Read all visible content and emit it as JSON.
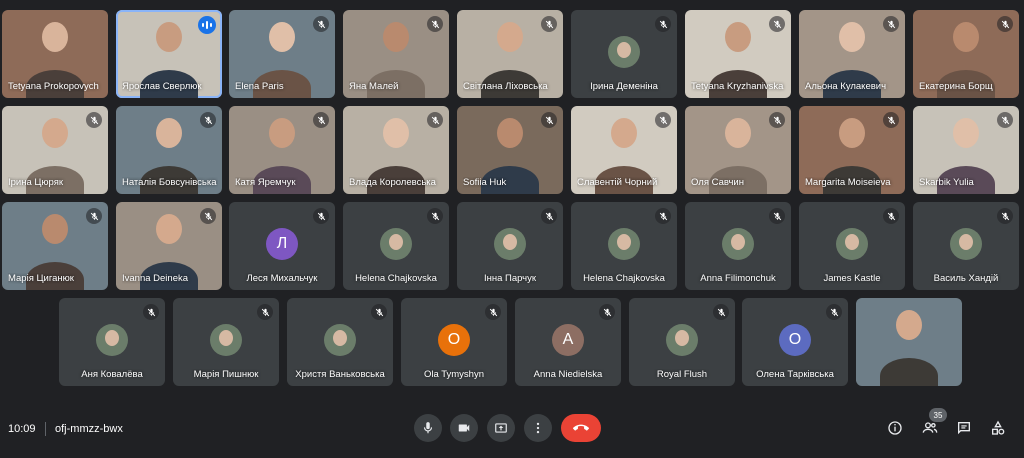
{
  "meeting": {
    "time": "10:09",
    "code": "ofj-mmzz-bwx",
    "participant_count": "35"
  },
  "colors": {
    "background": "#202124",
    "tile": "#3c4043",
    "end_call": "#ea4335",
    "active_speaker": "#1a73e8"
  },
  "rows": [
    [
      {
        "name": "Tetyana Prokopovych",
        "type": "video",
        "muted": false,
        "speaking": false
      },
      {
        "name": "Ярослав Сверлюк",
        "type": "video",
        "muted": false,
        "speaking": true
      },
      {
        "name": "Elena Paris",
        "type": "video",
        "muted": true
      },
      {
        "name": "Яна Малей",
        "type": "video",
        "muted": true
      },
      {
        "name": "Світлана Ліховська",
        "type": "video",
        "muted": true
      },
      {
        "name": "Ірина Деменіна",
        "type": "avatar",
        "avatar_kind": "photo",
        "muted": true
      },
      {
        "name": "Tetyana Kryzhanivska",
        "type": "video",
        "muted": true
      },
      {
        "name": "Альона Кулакевич",
        "type": "video",
        "muted": true
      },
      {
        "name": "Екатерина Борщ",
        "type": "video",
        "muted": true
      }
    ],
    [
      {
        "name": "Ірина Цюряк",
        "type": "video",
        "muted": true
      },
      {
        "name": "Наталія Бовсунівська",
        "type": "video",
        "muted": true
      },
      {
        "name": "Катя Яремчук",
        "type": "video",
        "muted": true
      },
      {
        "name": "Влада Королевська",
        "type": "video",
        "muted": true
      },
      {
        "name": "Sofiia Huk",
        "type": "video",
        "muted": true
      },
      {
        "name": "Славентій Чорний",
        "type": "video",
        "muted": true
      },
      {
        "name": "Оля Савчин",
        "type": "video",
        "muted": true
      },
      {
        "name": "Margarita Moiseieva",
        "type": "video",
        "muted": true
      },
      {
        "name": "Skarbik Yulia",
        "type": "video",
        "muted": true
      }
    ],
    [
      {
        "name": "Марія Циганюк",
        "type": "video",
        "muted": true
      },
      {
        "name": "Ivanna Deineka",
        "type": "video",
        "muted": true
      },
      {
        "name": "Леся Михальчук",
        "type": "avatar",
        "avatar_kind": "letter",
        "letter": "Л",
        "avatar_color": "#7e57c2",
        "muted": true
      },
      {
        "name": "Helena Chajkovska",
        "type": "avatar",
        "avatar_kind": "photo",
        "muted": true
      },
      {
        "name": "Інна Парчук",
        "type": "avatar",
        "avatar_kind": "photo",
        "muted": true
      },
      {
        "name": "Helena Chajkovska",
        "type": "avatar",
        "avatar_kind": "photo",
        "muted": true
      },
      {
        "name": "Anna Filimonchuk",
        "type": "avatar",
        "avatar_kind": "photo",
        "muted": true
      },
      {
        "name": "James Kastle",
        "type": "avatar",
        "avatar_kind": "photo",
        "muted": true
      },
      {
        "name": "Василь Хандій",
        "type": "avatar",
        "avatar_kind": "photo",
        "muted": true
      }
    ],
    [
      {
        "name": "Аня Ковалёва",
        "type": "avatar",
        "avatar_kind": "photo",
        "muted": true
      },
      {
        "name": "Марія Пишнюк",
        "type": "avatar",
        "avatar_kind": "photo",
        "muted": true
      },
      {
        "name": "Христя Ваньковська",
        "type": "avatar",
        "avatar_kind": "photo",
        "muted": true
      },
      {
        "name": "Ola Tymyshyn",
        "type": "avatar",
        "avatar_kind": "letter",
        "letter": "O",
        "avatar_color": "#e8710a",
        "muted": true
      },
      {
        "name": "Anna Niedielska",
        "type": "avatar",
        "avatar_kind": "letter",
        "letter": "A",
        "avatar_color": "#8d6e63",
        "muted": true
      },
      {
        "name": "Royal Flush",
        "type": "avatar",
        "avatar_kind": "photo",
        "muted": true
      },
      {
        "name": "Олена Тарківська",
        "type": "avatar",
        "avatar_kind": "letter",
        "letter": "O",
        "avatar_color": "#5c6bc0",
        "muted": true
      },
      {
        "name": "",
        "type": "video",
        "muted": false,
        "self": true
      }
    ]
  ],
  "controls": [
    {
      "id": "mic",
      "icon": "microphone-icon"
    },
    {
      "id": "camera",
      "icon": "camera-icon"
    },
    {
      "id": "present",
      "icon": "present-screen-icon"
    },
    {
      "id": "more",
      "icon": "more-options-icon"
    },
    {
      "id": "end",
      "icon": "end-call-icon"
    }
  ],
  "right_controls": [
    {
      "id": "info",
      "icon": "info-icon"
    },
    {
      "id": "people",
      "icon": "people-icon"
    },
    {
      "id": "chat",
      "icon": "chat-icon"
    },
    {
      "id": "activities",
      "icon": "activities-icon"
    }
  ]
}
